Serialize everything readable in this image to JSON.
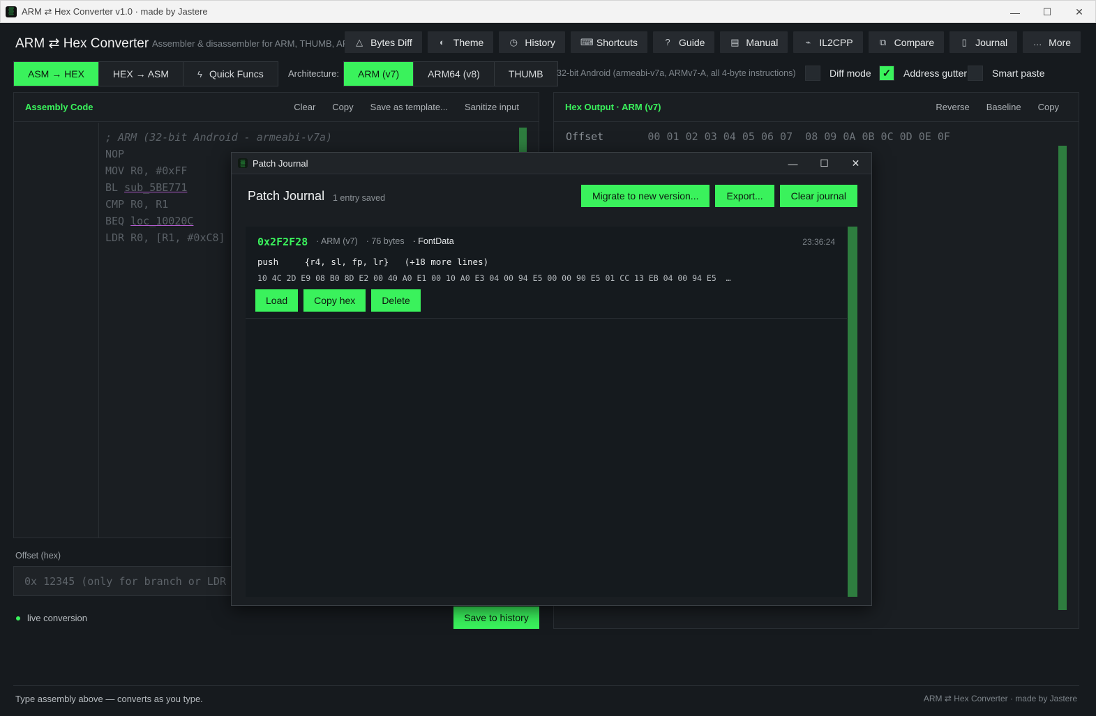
{
  "window": {
    "title": "ARM ⇄ Hex Converter v1.0 · made by Jastere",
    "minimize": "—",
    "maximize": "☐",
    "close": "✕"
  },
  "header": {
    "title": "ARM ⇄ Hex Converter",
    "subtitle": "Assembler & disassembler for ARM, THUMB, ARM64",
    "toolbar": [
      {
        "label": "Bytes Diff",
        "icon": "bytes-diff-icon",
        "glyph": "△"
      },
      {
        "label": "Theme",
        "icon": "palette-icon",
        "glyph": "◐"
      },
      {
        "label": "History",
        "icon": "clock-icon",
        "glyph": "◷"
      },
      {
        "label": "Shortcuts",
        "icon": "keyboard-icon",
        "glyph": "⌨"
      },
      {
        "label": "Guide",
        "icon": "question-icon",
        "glyph": "?"
      },
      {
        "label": "Manual",
        "icon": "book-icon",
        "glyph": "▤"
      },
      {
        "label": "IL2CPP",
        "icon": "plug-icon",
        "glyph": "⌁"
      },
      {
        "label": "Compare",
        "icon": "compare-icon",
        "glyph": "⧉"
      },
      {
        "label": "Journal",
        "icon": "journal-icon",
        "glyph": "▯"
      },
      {
        "label": "More",
        "icon": "ellipsis-icon",
        "glyph": "…"
      }
    ]
  },
  "modes": [
    {
      "label": "ASM → HEX",
      "active": true
    },
    {
      "label": "HEX → ASM",
      "active": false
    },
    {
      "label": "Quick Funcs",
      "active": false,
      "icon": "lightning-icon",
      "glyph": "ϟ"
    }
  ],
  "architecture": {
    "label": "Architecture:",
    "options": [
      {
        "label": "ARM (v7)",
        "active": true
      },
      {
        "label": "ARM64 (v8)",
        "active": false
      },
      {
        "label": "THUMB",
        "active": false
      }
    ],
    "description": "32-bit Android  (armeabi-v7a, ARMv7-A, all 4-byte instructions)"
  },
  "options": {
    "diff_mode": {
      "label": "Diff mode",
      "checked": false
    },
    "address_gutter": {
      "label": "Address gutter",
      "checked": true,
      "mark": "✓"
    },
    "smart_paste": {
      "label": "Smart paste",
      "checked": false
    }
  },
  "assembly_panel": {
    "title": "Assembly Code",
    "actions": [
      "Clear",
      "Copy",
      "Save as template...",
      "Sanitize input"
    ],
    "lines": [
      {
        "pre": "; ARM (32-bit Android - armeabi-v7a)",
        "ref": "",
        "comment": true
      },
      {
        "pre": "NOP",
        "ref": "",
        "comment": false
      },
      {
        "pre": "MOV R0, #0xFF",
        "ref": "",
        "comment": false
      },
      {
        "pre": "BL ",
        "ref": "sub_5BE771",
        "comment": false
      },
      {
        "pre": "CMP R0, R1",
        "ref": "",
        "comment": false
      },
      {
        "pre": "BEQ ",
        "ref": "loc_10020C",
        "comment": false
      },
      {
        "pre": "LDR R0, [R1, #0xC8]",
        "ref": "",
        "comment": false
      }
    ]
  },
  "hex_panel": {
    "title": "Hex Output · ARM (v7)",
    "actions": [
      "Reverse",
      "Baseline",
      "Copy"
    ],
    "offset_header": "Offset",
    "byte_header": "00 01 02 03 04 05 06 07  08 09 0A 0B 0C 0D 0E 0F"
  },
  "offset": {
    "label": "Offset (hex)",
    "placeholder": "0x 12345  (only for branch or LDR"
  },
  "live": "live conversion",
  "save_history": "Save to history",
  "status": {
    "left": "Type assembly above — converts as you type.",
    "right": "ARM ⇄ Hex Converter · made by Jastere"
  },
  "journal_modal": {
    "window_title": "Patch Journal",
    "heading": "Patch Journal",
    "count": "1 entry saved",
    "actions": [
      "Migrate to new version...",
      "Export...",
      "Clear journal"
    ],
    "entries": [
      {
        "address": "0x2F2F28",
        "arch": "· ARM (v7)",
        "size": "· 76 bytes",
        "name": "· FontData",
        "time": "23:36:24",
        "asm_preview": "push     {r4, sl, fp, lr}   (+18 more lines)",
        "hex_preview": "10 4C 2D E9 08 B0 8D E2 00 40 A0 E1 00 10 A0 E3 04 00 94 E5 00 00 90 E5 01 CC 13 EB 04 00 94 E5  …",
        "buttons": [
          "Load",
          "Copy hex",
          "Delete"
        ]
      }
    ]
  },
  "colors": {
    "accent": "#3af25c",
    "background": "#161a1e",
    "panel": "#1a1e22",
    "scrollbar": "#2e7d3f"
  }
}
